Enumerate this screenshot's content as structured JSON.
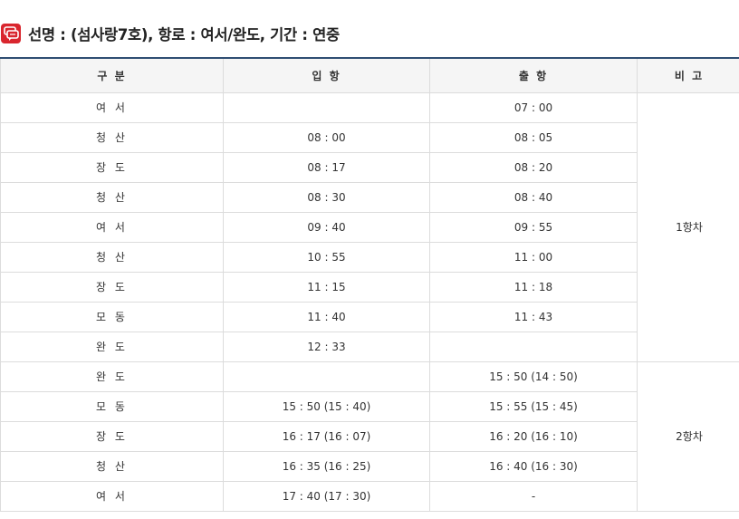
{
  "heading": {
    "text": "선명 : (섬사랑7호), 항로 : 여서/완도, 기간 : 연중"
  },
  "table": {
    "headers": {
      "gubun": "구 분",
      "arrival": "입 항",
      "departure": "출 항",
      "note": "비 고"
    },
    "groups": [
      {
        "note": "1항차",
        "rows": [
          {
            "port": "여 서",
            "arrival": "",
            "departure": "07 : 00"
          },
          {
            "port": "청 산",
            "arrival": "08 : 00",
            "departure": "08 : 05"
          },
          {
            "port": "장 도",
            "arrival": "08 : 17",
            "departure": "08 : 20"
          },
          {
            "port": "청 산",
            "arrival": "08 : 30",
            "departure": "08 : 40"
          },
          {
            "port": "여 서",
            "arrival": "09 : 40",
            "departure": "09 : 55"
          },
          {
            "port": "청 산",
            "arrival": "10 : 55",
            "departure": "11 : 00"
          },
          {
            "port": "장 도",
            "arrival": "11 : 15",
            "departure": "11 : 18"
          },
          {
            "port": "모 동",
            "arrival": "11 : 40",
            "departure": "11 : 43"
          },
          {
            "port": "완 도",
            "arrival": "12 : 33",
            "departure": ""
          }
        ]
      },
      {
        "note": "2항차",
        "rows": [
          {
            "port": "완 도",
            "arrival": "",
            "departure": "15 : 50 (14 : 50)"
          },
          {
            "port": "모 동",
            "arrival": "15 : 50 (15 : 40)",
            "departure": "15 : 55 (15 : 45)"
          },
          {
            "port": "장 도",
            "arrival": "16 : 17 (16 : 07)",
            "departure": "16 : 20 (16 : 10)"
          },
          {
            "port": "청 산",
            "arrival": "16 : 35 (16 : 25)",
            "departure": "16 : 40 (16 : 30)"
          },
          {
            "port": "여 서",
            "arrival": "17 : 40 (17 : 30)",
            "departure": "-"
          }
        ]
      }
    ]
  },
  "colors": {
    "icon": "#d9262e",
    "header_top_border": "#2f4e73",
    "header_bg": "#f5f5f5",
    "grid": "#dcdcdc"
  }
}
